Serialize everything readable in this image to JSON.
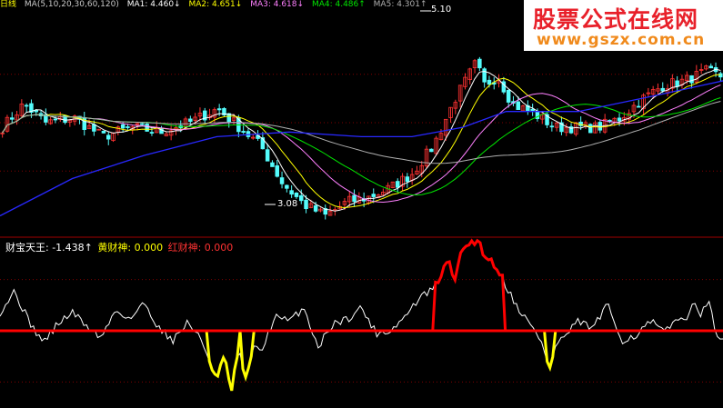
{
  "header": {
    "period": "日线",
    "ma_params": "MA(5,10,20,30,60,120)",
    "ma1": "MA1: 4.460↓",
    "ma2": "MA2: 4.651↓",
    "ma3": "MA3: 4.618↓",
    "ma4": "MA4: 4.486↑",
    "ma5": "MA5: 4.301↑"
  },
  "indicator_header": {
    "name": "财宝天王: -1.438↑",
    "yellow": "黄财神: 0.000",
    "red": "红财神: 0.000"
  },
  "annotations": {
    "high": "5.10",
    "low": "3.08"
  },
  "watermark": {
    "title": "股票公式在线网",
    "url": "www.gszx.com.cn"
  },
  "colors": {
    "up": "#ff3232",
    "down": "#54fcfc",
    "ma1": "#ffffff",
    "ma2": "#ffff00",
    "ma3": "#ff80ff",
    "ma4": "#00e600",
    "ma5": "#b0b0b0",
    "ma6": "#2828ff",
    "indicator_line": "#ffffff",
    "yellow_line": "#ffff00",
    "red_line": "#ff0000",
    "zero_line": "#ff0000",
    "grid": "#800000"
  },
  "chart_data": [
    {
      "type": "line",
      "subtype": "candlestick",
      "x_range": [
        0,
        100
      ],
      "ylim": [
        2.9,
        5.3
      ],
      "price_path": [
        [
          0,
          4.05
        ],
        [
          3,
          4.3
        ],
        [
          6,
          4.1
        ],
        [
          10,
          4.15
        ],
        [
          14,
          3.95
        ],
        [
          18,
          4.05
        ],
        [
          22,
          4.0
        ],
        [
          26,
          4.1
        ],
        [
          30,
          4.25
        ],
        [
          33,
          4.05
        ],
        [
          36,
          3.85
        ],
        [
          39,
          3.45
        ],
        [
          42,
          3.22
        ],
        [
          45,
          3.1
        ],
        [
          48,
          3.25
        ],
        [
          51,
          3.3
        ],
        [
          54,
          3.4
        ],
        [
          57,
          3.55
        ],
        [
          60,
          3.85
        ],
        [
          63,
          4.35
        ],
        [
          66,
          4.75
        ],
        [
          67,
          4.5
        ],
        [
          69,
          4.6
        ],
        [
          71,
          4.3
        ],
        [
          74,
          4.2
        ],
        [
          77,
          4.05
        ],
        [
          80,
          4.05
        ],
        [
          83,
          4.05
        ],
        [
          86,
          4.15
        ],
        [
          89,
          4.35
        ],
        [
          92,
          4.5
        ],
        [
          95,
          4.55
        ],
        [
          98,
          4.65
        ],
        [
          100,
          4.6
        ]
      ],
      "ma": [
        {
          "name": "MA1",
          "period": 5
        },
        {
          "name": "MA2",
          "period": 10
        },
        {
          "name": "MA3",
          "period": 20
        },
        {
          "name": "MA4",
          "period": 30
        },
        {
          "name": "MA5",
          "period": 60
        },
        {
          "name": "MA6",
          "period": 120
        }
      ],
      "long_ma_path": [
        [
          0,
          3.1
        ],
        [
          10,
          3.5
        ],
        [
          20,
          3.75
        ],
        [
          30,
          3.95
        ],
        [
          40,
          4.0
        ],
        [
          50,
          3.95
        ],
        [
          57,
          3.95
        ],
        [
          64,
          4.05
        ],
        [
          70,
          4.22
        ],
        [
          80,
          4.22
        ],
        [
          90,
          4.38
        ],
        [
          100,
          4.55
        ]
      ],
      "high_value": 5.1,
      "low_value": 3.08
    },
    {
      "type": "line",
      "x_range": [
        0,
        100
      ],
      "ylim": [
        -3.2,
        3.2
      ],
      "zero_line": 0,
      "main_path": [
        [
          0,
          0.8
        ],
        [
          2,
          1.7
        ],
        [
          4,
          0.4
        ],
        [
          6,
          -0.5
        ],
        [
          8,
          0.3
        ],
        [
          10,
          0.8
        ],
        [
          12,
          0.2
        ],
        [
          14,
          -0.3
        ],
        [
          16,
          0.9
        ],
        [
          18,
          0.5
        ],
        [
          20,
          1.2
        ],
        [
          22,
          0.1
        ],
        [
          24,
          -0.4
        ],
        [
          26,
          0.4
        ],
        [
          28,
          -0.5
        ],
        [
          30,
          -2.1
        ],
        [
          31,
          -1.1
        ],
        [
          32,
          -2.6
        ],
        [
          33,
          -0.8
        ],
        [
          34,
          -2.2
        ],
        [
          35,
          -0.6
        ],
        [
          36,
          -1.0
        ],
        [
          38,
          0.6
        ],
        [
          40,
          0.4
        ],
        [
          42,
          1.0
        ],
        [
          44,
          -0.7
        ],
        [
          46,
          0.3
        ],
        [
          48,
          0.5
        ],
        [
          50,
          1.0
        ],
        [
          52,
          -0.1
        ],
        [
          54,
          0.0
        ],
        [
          56,
          0.6
        ],
        [
          58,
          1.4
        ],
        [
          60,
          1.8
        ],
        [
          62,
          3.0
        ],
        [
          63,
          2.2
        ],
        [
          64,
          3.6
        ],
        [
          66,
          3.9
        ],
        [
          67,
          3.3
        ],
        [
          69,
          2.6
        ],
        [
          71,
          1.3
        ],
        [
          73,
          0.4
        ],
        [
          75,
          -0.5
        ],
        [
          76,
          -1.7
        ],
        [
          77,
          -0.5
        ],
        [
          78,
          -0.3
        ],
        [
          80,
          0.4
        ],
        [
          82,
          0.1
        ],
        [
          84,
          1.1
        ],
        [
          86,
          -0.4
        ],
        [
          88,
          -0.2
        ],
        [
          90,
          0.4
        ],
        [
          92,
          -0.1
        ],
        [
          94,
          0.7
        ],
        [
          95,
          0.3
        ],
        [
          96,
          1.4
        ],
        [
          97,
          0.7
        ],
        [
          98,
          1.2
        ],
        [
          99,
          0.0
        ],
        [
          100,
          -0.5
        ]
      ]
    }
  ]
}
